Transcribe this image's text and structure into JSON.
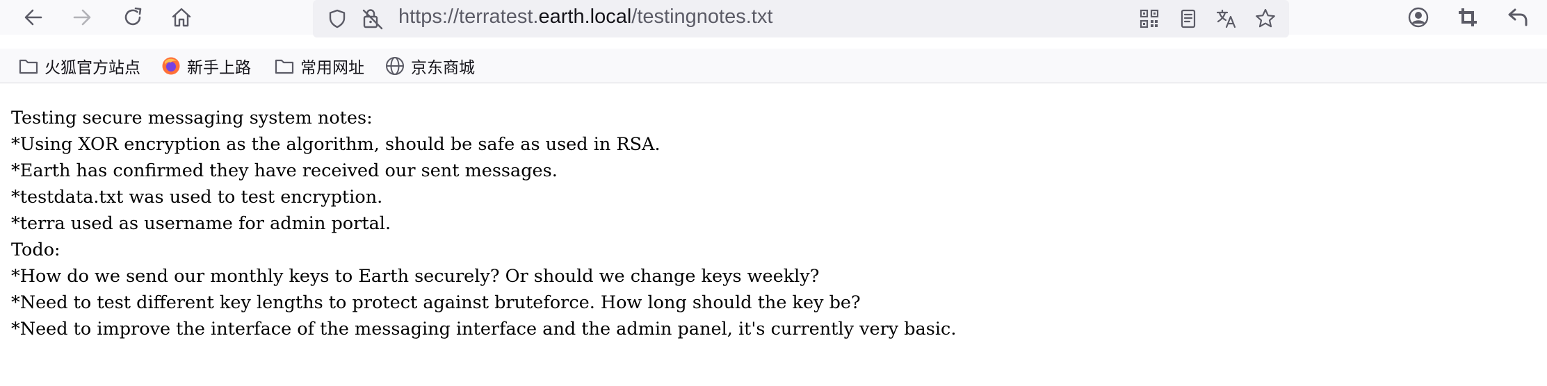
{
  "toolbar": {
    "back_icon": "arrow-left-icon",
    "forward_icon": "arrow-right-icon",
    "reload_icon": "reload-icon",
    "home_icon": "home-icon",
    "url": {
      "prefix": "https://terratest.",
      "host": "earth.local",
      "path": "/testingnotes.txt"
    },
    "right_icons": [
      "account-icon",
      "crop-icon",
      "undo-icon"
    ]
  },
  "bookmarks": [
    {
      "icon": "folder-icon",
      "label": "火狐官方站点"
    },
    {
      "icon": "firefox-icon",
      "label": "新手上路"
    },
    {
      "icon": "folder-icon",
      "label": "常用网址"
    },
    {
      "icon": "globe-icon",
      "label": "京东商城"
    }
  ],
  "document": {
    "lines": [
      "Testing secure messaging system notes:",
      "*Using XOR encryption as the algorithm, should be safe as used in RSA.",
      "*Earth has confirmed they have received our sent messages.",
      "*testdata.txt was used to test encryption.",
      "*terra used as username for admin portal.",
      "Todo:",
      "*How do we send our monthly keys to Earth securely? Or should we change keys weekly?",
      "*Need to test different key lengths to protect against bruteforce. How long should the key be?",
      "*Need to improve the interface of the messaging interface and the admin panel, it's currently very basic."
    ]
  },
  "colors": {
    "toolbar_bg": "#f9f9fb",
    "url_bar_bg": "#f0f0f4",
    "icon": "#5b5b66",
    "firefox_orange": "#ff7139",
    "firefox_purple": "#7543e3"
  }
}
